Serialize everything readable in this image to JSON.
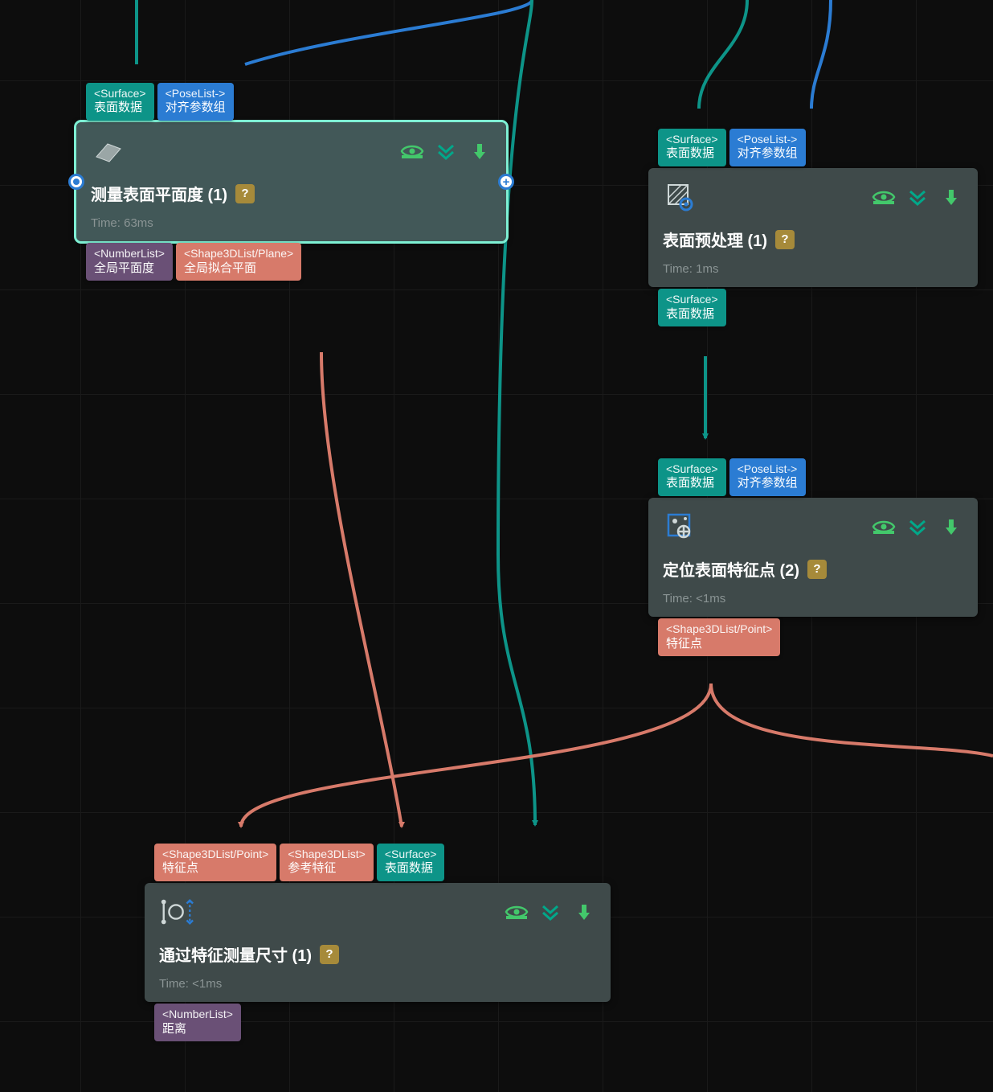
{
  "colors": {
    "teal": "#0d9488",
    "blue": "#2b7cd3",
    "purple": "#6a5076",
    "coral": "#d77a6a",
    "accent_green": "#43c86b",
    "accent_teal": "#00a88a"
  },
  "nodes": {
    "flatness": {
      "title": "测量表面平面度 (1)",
      "time": "Time: 63ms",
      "inputs": [
        {
          "type": "<Surface>",
          "label": "表面数据",
          "color": "teal"
        },
        {
          "type": "<PoseList->",
          "label": "对齐参数组",
          "color": "blue"
        }
      ],
      "outputs": [
        {
          "type": "<NumberList>",
          "label": "全局平面度",
          "color": "purple"
        },
        {
          "type": "<Shape3DList/Plane>",
          "label": "全局拟合平面",
          "color": "coral"
        }
      ]
    },
    "preprocess": {
      "title": "表面预处理 (1)",
      "time": "Time: 1ms",
      "inputs": [
        {
          "type": "<Surface>",
          "label": "表面数据",
          "color": "teal"
        },
        {
          "type": "<PoseList->",
          "label": "对齐参数组",
          "color": "blue"
        }
      ],
      "outputs": [
        {
          "type": "<Surface>",
          "label": "表面数据",
          "color": "teal"
        }
      ]
    },
    "locate": {
      "title": "定位表面特征点 (2)",
      "time": "Time: <1ms",
      "inputs": [
        {
          "type": "<Surface>",
          "label": "表面数据",
          "color": "teal"
        },
        {
          "type": "<PoseList->",
          "label": "对齐参数组",
          "color": "blue"
        }
      ],
      "outputs": [
        {
          "type": "<Shape3DList/Point>",
          "label": "特征点",
          "color": "coral"
        }
      ]
    },
    "measure": {
      "title": "通过特征测量尺寸 (1)",
      "time": "Time: <1ms",
      "inputs": [
        {
          "type": "<Shape3DList/Point>",
          "label": "特征点",
          "color": "coral"
        },
        {
          "type": "<Shape3DList>",
          "label": "参考特征",
          "color": "coral"
        },
        {
          "type": "<Surface>",
          "label": "表面数据",
          "color": "teal"
        }
      ],
      "outputs": [
        {
          "type": "<NumberList>",
          "label": "距离",
          "color": "purple"
        }
      ]
    }
  },
  "icons": {
    "eye": "eye-icon",
    "chevrons": "chevrons-down-icon",
    "arrow": "arrow-down-icon"
  }
}
